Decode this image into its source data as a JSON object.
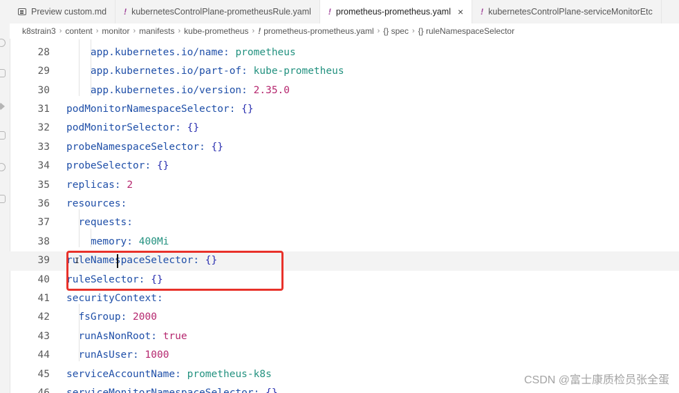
{
  "tabs": [
    {
      "label": "Preview custom.md",
      "icon": "markdown-preview-icon",
      "active": false
    },
    {
      "label": "kubernetesControlPlane-prometheusRule.yaml",
      "icon": "yaml-exclamation-icon",
      "active": false
    },
    {
      "label": "prometheus-prometheus.yaml",
      "icon": "yaml-exclamation-icon",
      "active": true,
      "close": "×"
    },
    {
      "label": "kubernetesControlPlane-serviceMonitorEtc",
      "icon": "yaml-exclamation-icon",
      "active": false
    }
  ],
  "icon_glyph": "!",
  "breadcrumb": [
    "k8strain3",
    "content",
    "monitor",
    "manifests",
    "kube-prometheus",
    "prometheus-prometheus.yaml",
    "{} spec",
    "{} ruleNamespaceSelector"
  ],
  "lines": [
    {
      "num": "28",
      "indent": 2,
      "key": "app.kubernetes.io/name",
      "value": "prometheus",
      "type": "s"
    },
    {
      "num": "29",
      "indent": 2,
      "key": "app.kubernetes.io/part-of",
      "value": "kube-prometheus",
      "type": "s"
    },
    {
      "num": "30",
      "indent": 2,
      "key": "app.kubernetes.io/version",
      "value": "2.35.0",
      "type": "n"
    },
    {
      "num": "31",
      "indent": 0,
      "key": "podMonitorNamespaceSelector",
      "value": "{}",
      "type": "b"
    },
    {
      "num": "32",
      "indent": 0,
      "key": "podMonitorSelector",
      "value": "{}",
      "type": "b"
    },
    {
      "num": "33",
      "indent": 0,
      "key": "probeNamespaceSelector",
      "value": "{}",
      "type": "b"
    },
    {
      "num": "34",
      "indent": 0,
      "key": "probeSelector",
      "value": "{}",
      "type": "b"
    },
    {
      "num": "35",
      "indent": 0,
      "key": "replicas",
      "value": "2",
      "type": "n"
    },
    {
      "num": "36",
      "indent": 0,
      "key": "resources",
      "value": "",
      "type": "none"
    },
    {
      "num": "37",
      "indent": 1,
      "key": "requests",
      "value": "",
      "type": "none"
    },
    {
      "num": "38",
      "indent": 2,
      "key": "memory",
      "value": "400Mi",
      "type": "s"
    },
    {
      "num": "39",
      "indent": 0,
      "key": "ruleNamespaceSelector",
      "value": "{}",
      "type": "b",
      "current": true
    },
    {
      "num": "40",
      "indent": 0,
      "key": "ruleSelector",
      "value": "{}",
      "type": "b"
    },
    {
      "num": "41",
      "indent": 0,
      "key": "securityContext",
      "value": "",
      "type": "none"
    },
    {
      "num": "42",
      "indent": 1,
      "key": "fsGroup",
      "value": "2000",
      "type": "n"
    },
    {
      "num": "43",
      "indent": 1,
      "key": "runAsNonRoot",
      "value": "true",
      "type": "n"
    },
    {
      "num": "44",
      "indent": 1,
      "key": "runAsUser",
      "value": "1000",
      "type": "n"
    },
    {
      "num": "45",
      "indent": 0,
      "key": "serviceAccountName",
      "value": "prometheus-k8s",
      "type": "s"
    },
    {
      "num": "46",
      "indent": 0,
      "key": "serviceMonitorNamespaceSelector",
      "value": "{}",
      "type": "b"
    }
  ],
  "watermark": "CSDN @富士康质检员张全蛋",
  "colors": {
    "highlight_box": "#e8312a",
    "yaml_icon": "#a0449a"
  }
}
